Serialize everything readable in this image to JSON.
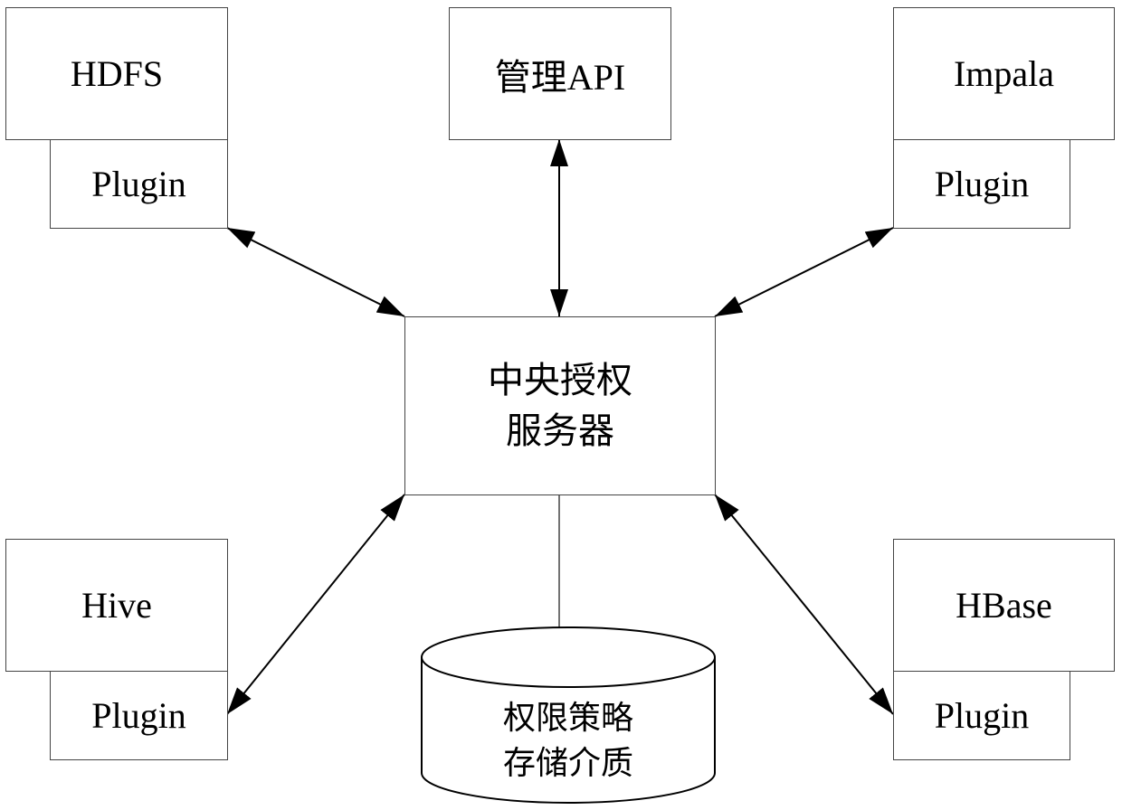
{
  "diagram": {
    "type": "architecture",
    "central_node": {
      "line1": "中央授权",
      "line2": "服务器"
    },
    "management_api": {
      "label": "管理API"
    },
    "components": [
      {
        "id": "hdfs",
        "name": "HDFS",
        "plugin": "Plugin"
      },
      {
        "id": "impala",
        "name": "Impala",
        "plugin": "Plugin"
      },
      {
        "id": "hive",
        "name": "Hive",
        "plugin": "Plugin"
      },
      {
        "id": "hbase",
        "name": "HBase",
        "plugin": "Plugin"
      }
    ],
    "storage": {
      "line1": "权限策略",
      "line2": "存储介质"
    },
    "edges": [
      {
        "from": "hdfs-plugin",
        "to": "central",
        "direction": "bidirectional"
      },
      {
        "from": "management-api",
        "to": "central",
        "direction": "bidirectional"
      },
      {
        "from": "impala-plugin",
        "to": "central",
        "direction": "bidirectional"
      },
      {
        "from": "central",
        "to": "hive-plugin",
        "direction": "bidirectional"
      },
      {
        "from": "central",
        "to": "hbase-plugin",
        "direction": "bidirectional"
      },
      {
        "from": "central",
        "to": "storage",
        "direction": "none"
      }
    ]
  }
}
